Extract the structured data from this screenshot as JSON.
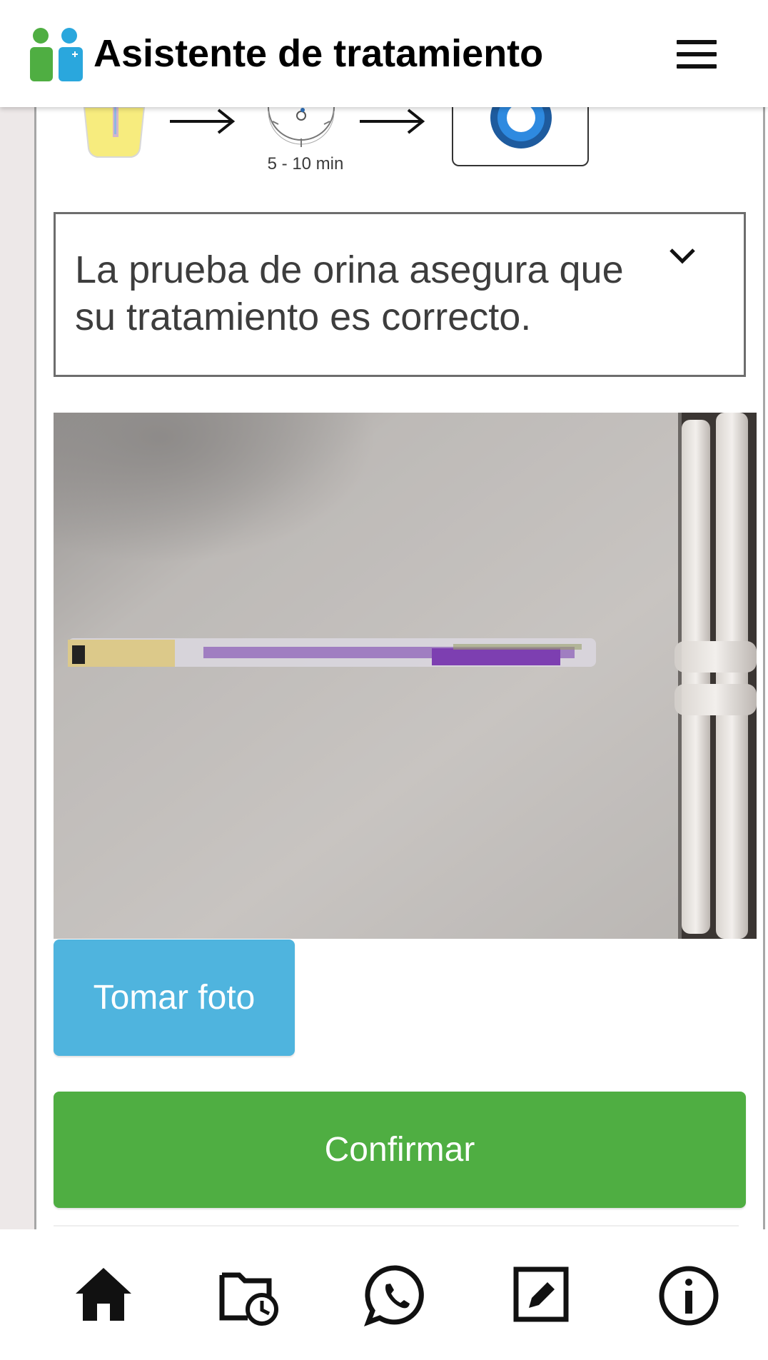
{
  "header": {
    "title": "Asistente de tratamiento",
    "logo_icon": "people-plus-logo",
    "menu_icon": "hamburger-menu-icon"
  },
  "steps": {
    "timer_label": "5 - 10 min"
  },
  "info": {
    "text": "La prueba de orina asegura que su tratamiento es correcto.",
    "expand_icon": "chevron-down-icon"
  },
  "buttons": {
    "take_photo": "Tomar foto",
    "confirm": "Confirmar"
  },
  "bottom_nav": [
    {
      "name": "home",
      "icon": "home-icon"
    },
    {
      "name": "history",
      "icon": "folder-clock-icon"
    },
    {
      "name": "whatsapp",
      "icon": "whatsapp-icon"
    },
    {
      "name": "edit",
      "icon": "edit-icon"
    },
    {
      "name": "info",
      "icon": "info-icon"
    }
  ],
  "colors": {
    "take_photo_button": "#4fb4de",
    "confirm_button": "#4fae42",
    "logo_green": "#4fae42",
    "logo_blue": "#2aa7dd"
  }
}
